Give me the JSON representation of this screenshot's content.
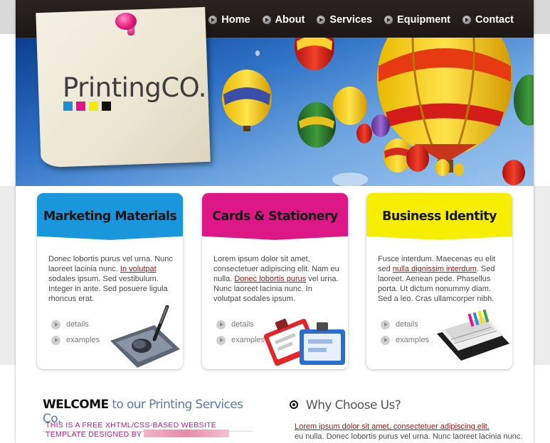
{
  "nav": {
    "items": [
      {
        "label": "Home"
      },
      {
        "label": "About"
      },
      {
        "label": "Services"
      },
      {
        "label": "Equipment"
      },
      {
        "label": "Contact"
      }
    ]
  },
  "logo": {
    "text": "PrintingCO.",
    "swatch_colors": [
      "#1a8fd8",
      "#e0158c",
      "#f6ea00",
      "#111111"
    ]
  },
  "cards": [
    {
      "title": "Marketing Materials",
      "head_color": "#1a97dc",
      "text_before": "Donec lobortis purus vel urna. Nunc laoreet lacinia nunc. ",
      "link": "In volutpat",
      "text_after": " sodales ipsum. Sed vestibulum. Integer in ante. Sed posuere ligula rhoncus erat.",
      "links": [
        "details",
        "examples"
      ],
      "icon": "drawing-tablet-icon"
    },
    {
      "title": "Cards & Stationery",
      "head_color": "#de1786",
      "text_before": "Lorem ipsum dolor sit amet, consectetuer adipiscing elit. Nam eu nulla. ",
      "link": "Donec lobortis purus",
      "text_after": " vel urna. Nunc laoreet lacinia nunc. In volutpat sodales ipsum.",
      "links": [
        "details",
        "examples"
      ],
      "icon": "id-badges-icon"
    },
    {
      "title": "Business Identity",
      "head_color": "#f6ee00",
      "text_before": "Fusce interdum. Maecenas eu elit sed ",
      "link": "nulla dignissim interdum",
      "text_after": ". Sed laoreet. Aenean pede. Phasellus porta. Ut dictum nonummy diam. Sed a leo. Cras ullamcorper nibh.",
      "links": [
        "details",
        "examples"
      ],
      "icon": "checkbook-icon"
    }
  ],
  "welcome": {
    "strong": "WELCOME",
    "rest": " to our Printing Services Co.",
    "free_text": "THIS IS A FREE XHTML/CSS-BASED WEBSITE TEMPLATE DESIGNED BY"
  },
  "why": {
    "title": "Why Choose Us?",
    "link": "Lorem ipsum dolor sit amet, consectetuer adipiscing elit.",
    "text": "eu nulla. Donec lobortis purus vel urna. Nunc laoreet lacinia nunc."
  }
}
